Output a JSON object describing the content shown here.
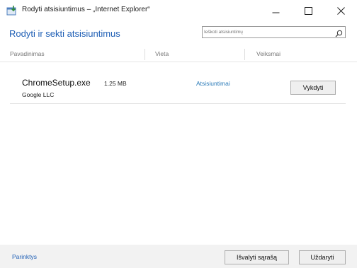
{
  "window": {
    "title": "Rodyti atsisiuntimus – „Internet Explorer“",
    "minimize_icon": "minimize-icon",
    "maximize_icon": "maximize-icon",
    "close_icon": "close-icon"
  },
  "header": {
    "title": "Rodyti ir sekti atsisiuntimus",
    "accent_color": "#1f5fb5"
  },
  "search": {
    "placeholder": "Ieškoti atsisiuntimų",
    "icon": "search-icon"
  },
  "columns": {
    "name": "Pavadinimas",
    "location": "Vieta",
    "actions": "Veiksmai"
  },
  "downloads": [
    {
      "name": "ChromeSetup.exe",
      "size": "1.25 MB",
      "publisher": "Google LLC",
      "location": "Atsisiuntimai",
      "action": "Vykdyti"
    }
  ],
  "footer": {
    "options": "Parinktys",
    "clear": "Išvalyti sąrašą",
    "close": "Uždaryti"
  },
  "link_color": "#2a7ab8"
}
